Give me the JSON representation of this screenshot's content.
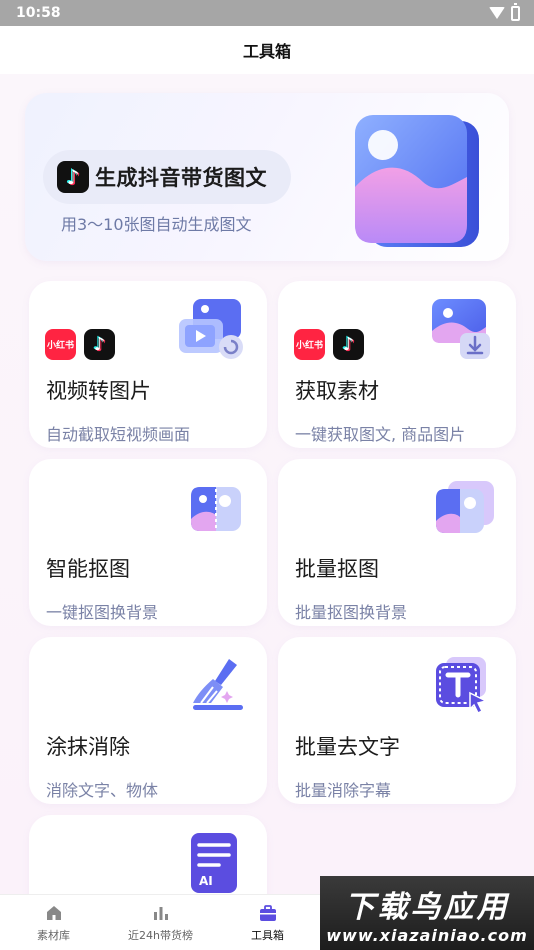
{
  "status_bar": {
    "time": "10:58"
  },
  "header": {
    "title": "工具箱"
  },
  "banner": {
    "title": "生成抖音带货图文",
    "subtitle": "用3～10张图自动生成图文"
  },
  "tools": [
    {
      "title": "视频转图片",
      "subtitle": "自动截取短视频画面",
      "badges": [
        "小红书",
        "tiktok-icon"
      ],
      "icon": "video-to-image-icon"
    },
    {
      "title": "获取素材",
      "subtitle": "一键获取图文, 商品图片",
      "badges": [
        "小红书",
        "tiktok-icon"
      ],
      "icon": "download-image-icon"
    },
    {
      "title": "智能抠图",
      "subtitle": "一键抠图换背景",
      "icon": "cutout-icon"
    },
    {
      "title": "批量抠图",
      "subtitle": "批量抠图换背景",
      "icon": "batch-cutout-icon"
    },
    {
      "title": "涂抹消除",
      "subtitle": "消除文字、物体",
      "icon": "brush-erase-icon"
    },
    {
      "title": "批量去文字",
      "subtitle": "批量消除字幕",
      "icon": "text-remove-icon"
    }
  ],
  "partial_card": {
    "icon": "ai-document-icon",
    "icon_text": "AI"
  },
  "tabbar": {
    "items": [
      {
        "label": "素材库",
        "icon": "home-icon"
      },
      {
        "label": "近24h带货榜",
        "icon": "bar-chart-icon"
      },
      {
        "label": "工具箱",
        "icon": "toolbox-icon",
        "active": true
      }
    ]
  },
  "watermark": {
    "title": "下载鸟应用",
    "url": "www.xiazainiao.com"
  },
  "colors": {
    "accent": "#7b5cf0",
    "brand_red": "#ff2442",
    "subtitle": "#7a82a6"
  }
}
